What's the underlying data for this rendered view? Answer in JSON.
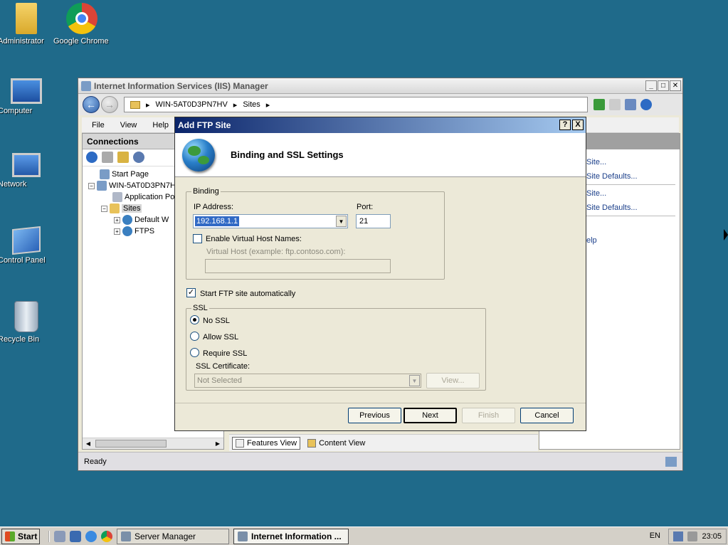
{
  "desktop": {
    "icons": [
      {
        "label": "Administrator"
      },
      {
        "label": "Google Chrome"
      },
      {
        "label": "Computer"
      },
      {
        "label": "Network"
      },
      {
        "label": "Control Panel"
      },
      {
        "label": "Recycle Bin"
      }
    ]
  },
  "iis": {
    "title": "Internet Information Services (IIS) Manager",
    "breadcrumb": [
      "WIN-5AT0D3PN7HV",
      "Sites"
    ],
    "menu": [
      "File",
      "View",
      "Help"
    ],
    "connections": {
      "header": "Connections",
      "tree": [
        "Start Page",
        "WIN-5AT0D3PN7H",
        "Application Po",
        "Sites",
        "Default W",
        "FTPS"
      ]
    },
    "actions": [
      "Site...",
      "Site Defaults...",
      "Site...",
      "Site Defaults...",
      "elp"
    ],
    "view_tabs": [
      "Features View",
      "Content View"
    ],
    "status": "Ready"
  },
  "dialog": {
    "title": "Add FTP Site",
    "help_btn": "?",
    "close_btn": "X",
    "heading": "Binding and SSL Settings",
    "binding": {
      "legend": "Binding",
      "ip_label": "IP Address:",
      "ip_value": "192.168.1.1",
      "port_label": "Port:",
      "port_value": "21",
      "vhost_check_label": "Enable Virtual Host Names:",
      "vhost_label": "Virtual Host (example: ftp.contoso.com):",
      "vhost_value": ""
    },
    "autostart_label": "Start FTP site automatically",
    "autostart_checked": true,
    "ssl": {
      "legend": "SSL",
      "options": [
        "No SSL",
        "Allow SSL",
        "Require SSL"
      ],
      "selected": "No SSL",
      "cert_label": "SSL Certificate:",
      "cert_value": "Not Selected",
      "view_btn": "View..."
    },
    "buttons": {
      "previous": "Previous",
      "next": "Next",
      "finish": "Finish",
      "cancel": "Cancel"
    }
  },
  "taskbar": {
    "start": "Start",
    "tasks": [
      "Server Manager",
      "Internet Information ..."
    ],
    "lang": "EN",
    "clock": "23:05"
  }
}
